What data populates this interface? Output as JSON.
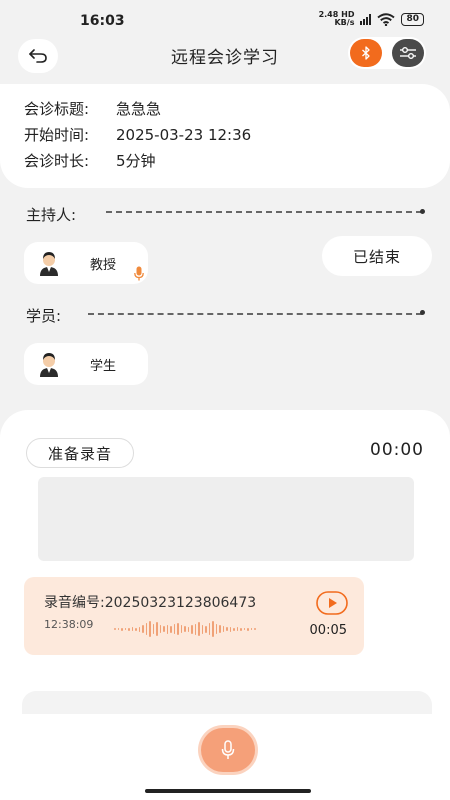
{
  "status_bar": {
    "time": "16:03",
    "net_speed_top": "2.48",
    "net_speed_unit": "KB/s",
    "network_type": "HD",
    "battery": "80"
  },
  "header": {
    "title": "远程会诊学习",
    "back_icon": "back-arrow-icon",
    "bluetooth_icon": "bluetooth-icon",
    "settings_icon": "sliders-icon"
  },
  "consultation": {
    "topic_label": "会诊标题:",
    "topic_value": "急急急",
    "start_label": "开始时间:",
    "start_value": "2025-03-23 12:36",
    "duration_label": "会诊时长:",
    "duration_value": "5分钟"
  },
  "host": {
    "section_label": "主持人:",
    "name": "教授"
  },
  "status_label": "已结束",
  "students": {
    "section_label": "学员:",
    "name": "学生"
  },
  "recording": {
    "prepare_label": "准备录音",
    "timer": "00:00",
    "item": {
      "id_label": "录音编号:",
      "id_value": "20250323123806473",
      "time": "12:38:09",
      "duration": "00:05"
    }
  },
  "colors": {
    "accent": "#f26b1d",
    "recording_bg": "#fde9dc",
    "mic_button": "#f5a079"
  }
}
